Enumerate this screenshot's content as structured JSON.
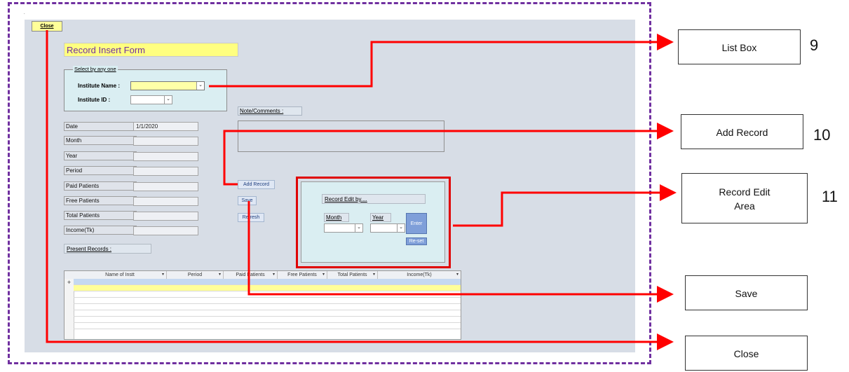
{
  "form": {
    "close_label": "Close",
    "title": "Record Insert Form",
    "group": {
      "label": "Select by any one",
      "institute_name_label": "Institute Name :",
      "institute_id_label": "Institute ID :"
    },
    "fields": [
      {
        "label": "Date",
        "value": "1/1/2020"
      },
      {
        "label": "Month",
        "value": ""
      },
      {
        "label": "Year",
        "value": ""
      },
      {
        "label": "Period",
        "value": ""
      },
      {
        "label": "Paid Patients",
        "value": ""
      },
      {
        "label": "Free Patients",
        "value": ""
      },
      {
        "label": "Total Patients",
        "value": ""
      },
      {
        "label": "Income(Tk)",
        "value": ""
      }
    ],
    "note_label": "Note/Comments :",
    "add_record_label": "Add Record",
    "save_label": "Save",
    "refresh_label": "Refresh",
    "edit": {
      "label": "Record Edit by....",
      "month_label": "Month",
      "year_label": "Year",
      "enter_label": "Enter",
      "reset_label": "Re-set"
    },
    "present_records_label": "Present Records :",
    "grid": {
      "columns": [
        "Name of Instt",
        "Period",
        "Paid Patients",
        "Free Patients",
        "Total Patients",
        "Income(Tk)"
      ],
      "new_row_marker": "+"
    }
  },
  "callouts": [
    {
      "label": "List Box",
      "number": "9"
    },
    {
      "label": "Add Record",
      "number": "10"
    },
    {
      "label": "Record Edit Area",
      "number": "11"
    },
    {
      "label": "Save",
      "number": ""
    },
    {
      "label": "Close",
      "number": ""
    }
  ],
  "colors": {
    "frame": "#7030a0",
    "arrow": "#ff0000",
    "title_bg": "#ffff80",
    "title_text": "#7030a0"
  }
}
